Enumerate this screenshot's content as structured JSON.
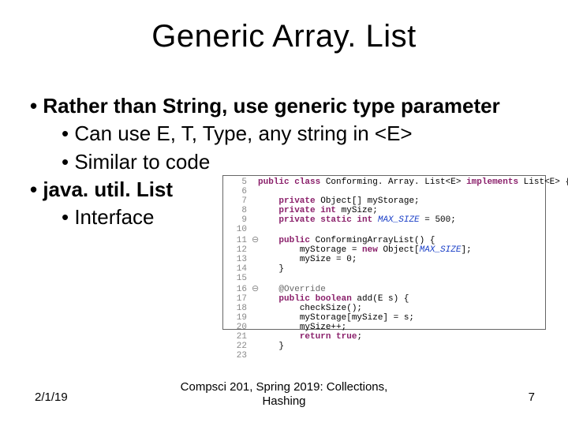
{
  "title": "Generic Array. List",
  "bullets": {
    "b1a": "Rather than String, use generic type parameter",
    "b2a": "Can use E, T, Type, any string in <E>",
    "b2b": "Similar to code",
    "b1b": "java. util. List",
    "b2c": "Interface"
  },
  "footer": {
    "date": "2/1/19",
    "center_l1": "Compsci 201, Spring 2019: Collections,",
    "center_l2": "Hashing",
    "page": "7"
  },
  "code": {
    "l5_a": "public class",
    "l5_b": " Conforming. Array. List<E> ",
    "l5_c": "implements",
    "l5_d": " List<E> {",
    "l7_a": "private",
    "l7_b": " Object[] myStorage;",
    "l8_a": "private int",
    "l8_b": " mySize;",
    "l9_a": "private static int",
    "l9_b": " ",
    "l9_c": "MAX_SIZE",
    "l9_d": " = 500;",
    "l11_a": "public",
    "l11_b": " ConformingArrayList() {",
    "l12_a": "myStorage = ",
    "l12_b": "new",
    "l12_c": " Object[",
    "l12_d": "MAX_SIZE",
    "l12_e": "];",
    "l13": "mySize = 0;",
    "l14": "}",
    "l16": "@Override",
    "l17_a": "public boolean",
    "l17_b": " add(E s) {",
    "l18": "checkSize();",
    "l19": "myStorage[mySize] = s;",
    "l20": "mySize++;",
    "l21_a": "return true",
    "l21_b": ";",
    "l22": "}"
  }
}
